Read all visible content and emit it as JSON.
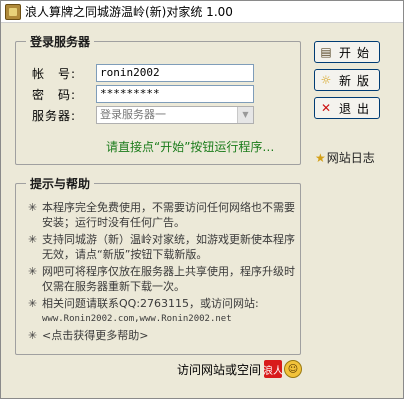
{
  "window": {
    "title": "浪人算牌之同城游温岭(新)对家统 1.00"
  },
  "login": {
    "legend": "登录服务器",
    "account_label": "帐　号:",
    "account_value": "ronin2002",
    "password_label": "密　码:",
    "password_value": "*********",
    "server_label": "服务器:",
    "server_value": "登录服务器一",
    "hint": "请直接点“开始”按钮运行程序…"
  },
  "buttons": {
    "start_label": "开始",
    "new_label": "新版",
    "exit_label": "退出"
  },
  "weblog": {
    "label": "网站日志"
  },
  "help": {
    "legend": "提示与帮助",
    "items": [
      {
        "bullet": "✳",
        "text": "本程序完全免费使用，不需要访问任何网络也不需要安装；运行时没有任何广告。"
      },
      {
        "bullet": "✳",
        "text": "支持同城游（新）温岭对家统，如游戏更新使本程序无效，请点“新版”按钮下载新版。"
      },
      {
        "bullet": "✳",
        "text": "网吧可将程序仅放在服务器上共享使用，程序升级时仅需在服务器重新下载一次。"
      },
      {
        "bullet": "✳",
        "text": "相关问题请联系QQ:2763115，或访问网站:"
      },
      {
        "bullet": "✳",
        "text": "<点击获得更多帮助>"
      }
    ],
    "urls": "www.Ronin2002.com,www.Ronin2002.net"
  },
  "footer": {
    "visit_text": "访问网站或空间",
    "badge_text": "浪人"
  },
  "icons": {
    "app": "app-icon",
    "start": "book-icon",
    "new": "lightbulb-icon",
    "exit": "close-icon",
    "weblog": "star-icon",
    "smiley": "smiley-icon"
  }
}
